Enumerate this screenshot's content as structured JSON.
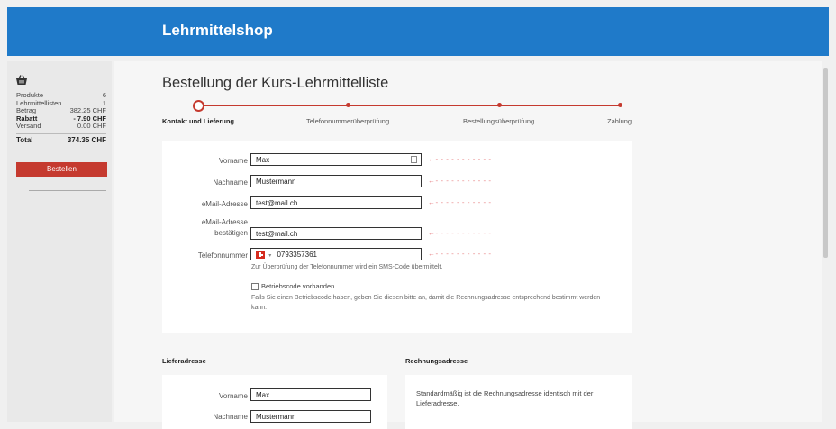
{
  "app": {
    "title": "Lehrmittelshop"
  },
  "sidebar": {
    "summary": [
      {
        "label": "Produkte",
        "value": "6",
        "bold": false
      },
      {
        "label": "Lehrmittellisten",
        "value": "1",
        "bold": false
      },
      {
        "label": "Betrag",
        "value": "382.25 CHF",
        "bold": false
      },
      {
        "label": "Rabatt",
        "value": "- 7.90 CHF",
        "bold": true
      },
      {
        "label": "Versand",
        "value": "0.00 CHF",
        "bold": false
      }
    ],
    "total": {
      "label": "Total",
      "value": "374.35 CHF"
    },
    "order_button": "Bestellen"
  },
  "page": {
    "title": "Bestellung der Kurs-Lehrmittelliste"
  },
  "steps": [
    {
      "label": "Kontakt und Lieferung",
      "active": true
    },
    {
      "label": "Telefonnummerüberprüfung",
      "active": false
    },
    {
      "label": "Bestellungsüberprüfung",
      "active": false
    },
    {
      "label": "Zahlung",
      "active": false
    }
  ],
  "contact": {
    "first_name": {
      "label": "Vorname",
      "value": "Max"
    },
    "last_name": {
      "label": "Nachname",
      "value": "Mustermann"
    },
    "email": {
      "label": "eMail-Adresse",
      "value": "test@mail.ch"
    },
    "email_confirm": {
      "label_line1": "eMail-Adresse",
      "label_line2": "bestätigen",
      "value": "test@mail.ch"
    },
    "phone": {
      "label": "Telefonnummer",
      "value": "0793357361",
      "hint": "Zur Überprüfung der Telefonnummer wird ein SMS-Code übermittelt."
    },
    "company_code": {
      "label": "Betriebscode vorhanden",
      "hint_line1": "Falls Sie einen Betriebscode haben, geben Sie diesen bitte an, damit die Rechnungsadresse entsprechend bestimmt werden",
      "hint_line2": "kann."
    },
    "arrow_glyph": "←- - - - - - - - - - -"
  },
  "delivery": {
    "title": "Lieferadresse",
    "first_name": {
      "label": "Vorname",
      "value": "Max"
    },
    "last_name": {
      "label": "Nachname",
      "value": "Mustermann"
    }
  },
  "billing": {
    "title": "Rechnungsadresse",
    "text_line1": "Standardmäßig ist die Rechnungsadresse identisch mit der",
    "text_line2": "Lieferadresse."
  },
  "colors": {
    "header": "#1f7ac9",
    "accent": "#c53a2f"
  }
}
